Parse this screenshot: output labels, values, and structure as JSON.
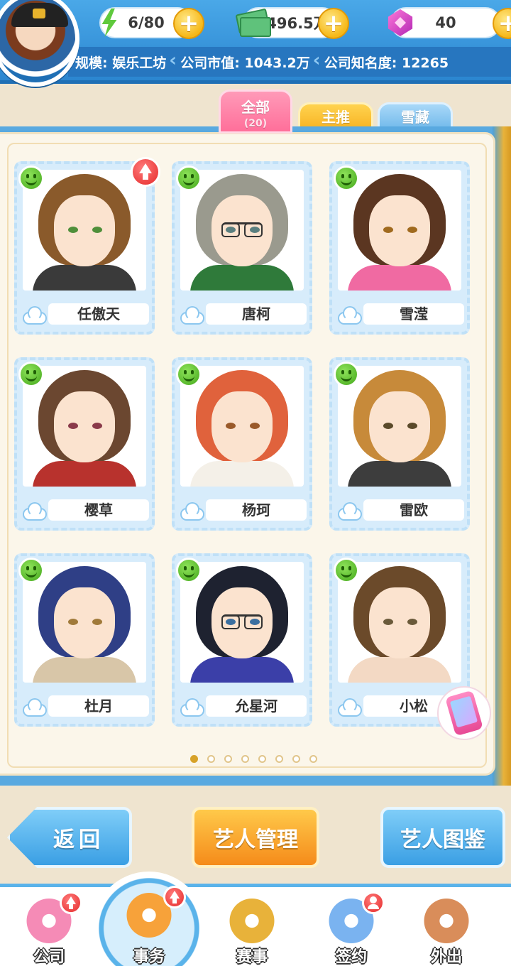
{
  "hud": {
    "energy": "6/80",
    "money": "496.5万",
    "gems": "40",
    "plus_label": "+",
    "scale_label": "规模: 娱乐工坊",
    "market_value_label": "公司市值: 1043.2万",
    "fame_label": "公司知名度: 12265"
  },
  "tabs": [
    {
      "label": "全部",
      "count": "(20)",
      "selected": true
    },
    {
      "label": "主推",
      "selected": false
    },
    {
      "label": "雪藏",
      "selected": false
    }
  ],
  "artists": [
    {
      "name": "任傲天",
      "hair": "#8a5a2b",
      "eye": "#4f8f3a",
      "body": "#3a3a3a",
      "upgrade": true,
      "glasses": false
    },
    {
      "name": "唐柯",
      "hair": "#9a9a8e",
      "eye": "#5a7f7f",
      "body": "#2f7a3a",
      "upgrade": false,
      "glasses": true
    },
    {
      "name": "雪滢",
      "hair": "#5b3621",
      "eye": "#a06a1e",
      "body": "#f06aa2",
      "upgrade": false,
      "glasses": false
    },
    {
      "name": "樱草",
      "hair": "#6b4730",
      "eye": "#8a3a4a",
      "body": "#b8322d",
      "upgrade": false,
      "glasses": false
    },
    {
      "name": "杨珂",
      "hair": "#e0623c",
      "eye": "#9a5a2a",
      "body": "#f4f0e8",
      "upgrade": false,
      "glasses": false
    },
    {
      "name": "雷欧",
      "hair": "#c78a3a",
      "eye": "#5a4a2a",
      "body": "#3d3d3d",
      "upgrade": false,
      "glasses": false
    },
    {
      "name": "杜月",
      "hair": "#2f3f86",
      "eye": "#a07a3a",
      "body": "#d8c6a8",
      "upgrade": false,
      "glasses": false
    },
    {
      "name": "允星河",
      "hair": "#1e2230",
      "eye": "#3a6fa0",
      "body": "#3b3fa8",
      "upgrade": false,
      "glasses": true
    },
    {
      "name": "小松",
      "hair": "#6b4a2a",
      "eye": "#6a5a3a",
      "body": "#f3d9c4",
      "upgrade": false,
      "glasses": false
    }
  ],
  "pagination": {
    "current": 1,
    "total": 8
  },
  "buttons": {
    "back": "返回",
    "manage": "艺人管理",
    "guide": "艺人图鉴"
  },
  "nav": [
    {
      "label": "公司",
      "badge": "upgrade",
      "active": false,
      "color": "#f58bb6"
    },
    {
      "label": "事务",
      "badge": "upgrade",
      "active": true,
      "color": "#f7a23a"
    },
    {
      "label": "赛事",
      "badge": "",
      "active": false,
      "color": "#e8b23a"
    },
    {
      "label": "签约",
      "badge": "person",
      "active": false,
      "color": "#7ab3f0"
    },
    {
      "label": "外出",
      "badge": "",
      "active": false,
      "color": "#d98d5a"
    }
  ]
}
